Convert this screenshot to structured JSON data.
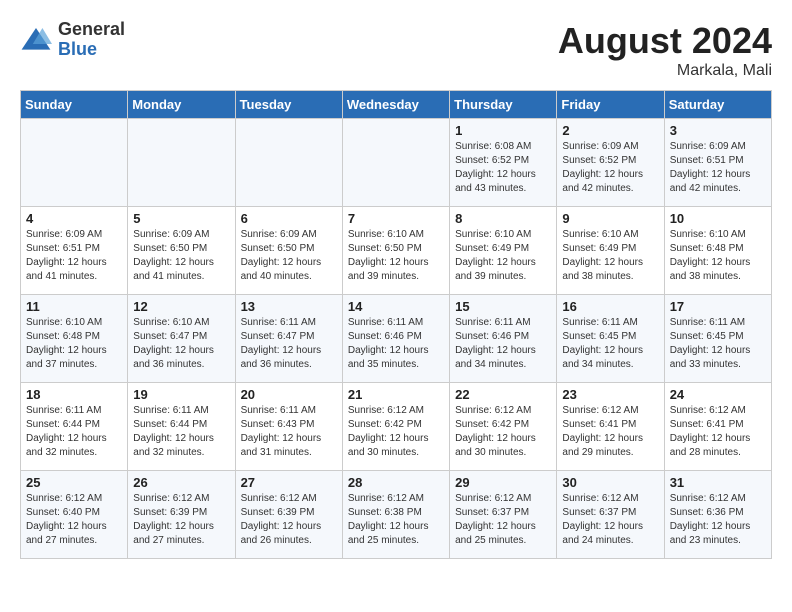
{
  "header": {
    "logo": {
      "general": "General",
      "blue": "Blue"
    },
    "month_year": "August 2024",
    "location": "Markala, Mali"
  },
  "days_of_week": [
    "Sunday",
    "Monday",
    "Tuesday",
    "Wednesday",
    "Thursday",
    "Friday",
    "Saturday"
  ],
  "weeks": [
    [
      {
        "day": "",
        "info": ""
      },
      {
        "day": "",
        "info": ""
      },
      {
        "day": "",
        "info": ""
      },
      {
        "day": "",
        "info": ""
      },
      {
        "day": "1",
        "info": "Sunrise: 6:08 AM\nSunset: 6:52 PM\nDaylight: 12 hours and 43 minutes."
      },
      {
        "day": "2",
        "info": "Sunrise: 6:09 AM\nSunset: 6:52 PM\nDaylight: 12 hours and 42 minutes."
      },
      {
        "day": "3",
        "info": "Sunrise: 6:09 AM\nSunset: 6:51 PM\nDaylight: 12 hours and 42 minutes."
      }
    ],
    [
      {
        "day": "4",
        "info": "Sunrise: 6:09 AM\nSunset: 6:51 PM\nDaylight: 12 hours and 41 minutes."
      },
      {
        "day": "5",
        "info": "Sunrise: 6:09 AM\nSunset: 6:50 PM\nDaylight: 12 hours and 41 minutes."
      },
      {
        "day": "6",
        "info": "Sunrise: 6:09 AM\nSunset: 6:50 PM\nDaylight: 12 hours and 40 minutes."
      },
      {
        "day": "7",
        "info": "Sunrise: 6:10 AM\nSunset: 6:50 PM\nDaylight: 12 hours and 39 minutes."
      },
      {
        "day": "8",
        "info": "Sunrise: 6:10 AM\nSunset: 6:49 PM\nDaylight: 12 hours and 39 minutes."
      },
      {
        "day": "9",
        "info": "Sunrise: 6:10 AM\nSunset: 6:49 PM\nDaylight: 12 hours and 38 minutes."
      },
      {
        "day": "10",
        "info": "Sunrise: 6:10 AM\nSunset: 6:48 PM\nDaylight: 12 hours and 38 minutes."
      }
    ],
    [
      {
        "day": "11",
        "info": "Sunrise: 6:10 AM\nSunset: 6:48 PM\nDaylight: 12 hours and 37 minutes."
      },
      {
        "day": "12",
        "info": "Sunrise: 6:10 AM\nSunset: 6:47 PM\nDaylight: 12 hours and 36 minutes."
      },
      {
        "day": "13",
        "info": "Sunrise: 6:11 AM\nSunset: 6:47 PM\nDaylight: 12 hours and 36 minutes."
      },
      {
        "day": "14",
        "info": "Sunrise: 6:11 AM\nSunset: 6:46 PM\nDaylight: 12 hours and 35 minutes."
      },
      {
        "day": "15",
        "info": "Sunrise: 6:11 AM\nSunset: 6:46 PM\nDaylight: 12 hours and 34 minutes."
      },
      {
        "day": "16",
        "info": "Sunrise: 6:11 AM\nSunset: 6:45 PM\nDaylight: 12 hours and 34 minutes."
      },
      {
        "day": "17",
        "info": "Sunrise: 6:11 AM\nSunset: 6:45 PM\nDaylight: 12 hours and 33 minutes."
      }
    ],
    [
      {
        "day": "18",
        "info": "Sunrise: 6:11 AM\nSunset: 6:44 PM\nDaylight: 12 hours and 32 minutes."
      },
      {
        "day": "19",
        "info": "Sunrise: 6:11 AM\nSunset: 6:44 PM\nDaylight: 12 hours and 32 minutes."
      },
      {
        "day": "20",
        "info": "Sunrise: 6:11 AM\nSunset: 6:43 PM\nDaylight: 12 hours and 31 minutes."
      },
      {
        "day": "21",
        "info": "Sunrise: 6:12 AM\nSunset: 6:42 PM\nDaylight: 12 hours and 30 minutes."
      },
      {
        "day": "22",
        "info": "Sunrise: 6:12 AM\nSunset: 6:42 PM\nDaylight: 12 hours and 30 minutes."
      },
      {
        "day": "23",
        "info": "Sunrise: 6:12 AM\nSunset: 6:41 PM\nDaylight: 12 hours and 29 minutes."
      },
      {
        "day": "24",
        "info": "Sunrise: 6:12 AM\nSunset: 6:41 PM\nDaylight: 12 hours and 28 minutes."
      }
    ],
    [
      {
        "day": "25",
        "info": "Sunrise: 6:12 AM\nSunset: 6:40 PM\nDaylight: 12 hours and 27 minutes."
      },
      {
        "day": "26",
        "info": "Sunrise: 6:12 AM\nSunset: 6:39 PM\nDaylight: 12 hours and 27 minutes."
      },
      {
        "day": "27",
        "info": "Sunrise: 6:12 AM\nSunset: 6:39 PM\nDaylight: 12 hours and 26 minutes."
      },
      {
        "day": "28",
        "info": "Sunrise: 6:12 AM\nSunset: 6:38 PM\nDaylight: 12 hours and 25 minutes."
      },
      {
        "day": "29",
        "info": "Sunrise: 6:12 AM\nSunset: 6:37 PM\nDaylight: 12 hours and 25 minutes."
      },
      {
        "day": "30",
        "info": "Sunrise: 6:12 AM\nSunset: 6:37 PM\nDaylight: 12 hours and 24 minutes."
      },
      {
        "day": "31",
        "info": "Sunrise: 6:12 AM\nSunset: 6:36 PM\nDaylight: 12 hours and 23 minutes."
      }
    ]
  ]
}
